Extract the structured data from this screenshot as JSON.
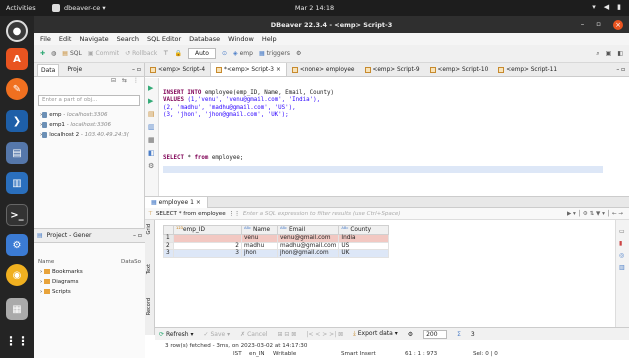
{
  "topbar": {
    "activities": "Activities",
    "app_name": "dbeaver-ce ▾",
    "clock": "Mar 2  14:18"
  },
  "window": {
    "title": "DBeaver 22.3.4 - <emp> Script-3"
  },
  "menubar": [
    "File",
    "Edit",
    "Navigate",
    "Search",
    "SQL Editor",
    "Database",
    "Window",
    "Help"
  ],
  "toolbar": {
    "sql": "SQL",
    "commit": "Commit",
    "rollback": "Rollback",
    "transaction_mode": "Auto",
    "schema": "emp",
    "triggers": "triggers"
  },
  "left_panel": {
    "tabs": [
      "Data",
      "Proje"
    ],
    "filter_placeholder": "Enter a part of obj...",
    "connections": [
      {
        "name": "emp",
        "host": "- localhost:3306"
      },
      {
        "name": "emp1",
        "host": "- localhost:3306"
      },
      {
        "name": "localhost 2",
        "host": "- 103.40.49.24:3("
      }
    ]
  },
  "project_panel": {
    "title": "Project - Gener",
    "col_name": "Name",
    "col_datasource": "DataSo",
    "items": [
      "Bookmarks",
      "Diagrams",
      "Scripts"
    ]
  },
  "editor_tabs": [
    {
      "label": "<emp> Script-4",
      "active": false
    },
    {
      "label": "*<emp> Script-3",
      "active": true
    },
    {
      "label": "<none> employee",
      "active": false
    },
    {
      "label": "<emp> Script-9",
      "active": false
    },
    {
      "label": "<emp> Script-10",
      "active": false
    },
    {
      "label": "<emp> Script-11",
      "active": false
    }
  ],
  "code": {
    "line1_kw": "INSERT INTO",
    "line1_rest": " employee(emp_ID, Name, Email, County)",
    "line2_kw": "VALUES",
    "line2_rest": " (1,'venu', 'venu@gmail.com', 'India'),",
    "line3": "(2, 'madhu', 'madhu@gmail.com', 'US'),",
    "line4": "(3, 'jhon', 'jhon@gmail.com', 'UK');",
    "select_kw1": "SELECT",
    "select_mid": " * ",
    "select_kw2": "from",
    "select_rest": " employee;"
  },
  "results": {
    "tab": "employee 1",
    "filter_query": "SELECT * from employee",
    "filter_placeholder": "Enter a SQL expression to filter results (use Ctrl+Space)",
    "vtabs": [
      "Grid",
      "Text",
      "Record"
    ],
    "columns": [
      "emp_ID",
      "Name",
      "Email",
      "County"
    ],
    "rows": [
      {
        "n": "1",
        "emp_id": "",
        "name": "venu",
        "email": "venu@gmail.com",
        "county": "India"
      },
      {
        "n": "2",
        "emp_id": "2",
        "name": "madhu",
        "email": "madhu@gmail.com",
        "county": "US"
      },
      {
        "n": "3",
        "emp_id": "3",
        "name": "jhon",
        "email": "jhon@gmail.com",
        "county": "UK"
      }
    ],
    "refresh": "Refresh",
    "save": "Save",
    "cancel": "Cancel",
    "export": "Export data",
    "fetch_size": "200",
    "row_count": "3",
    "status": "3 row(s) fetched - 3ms, on 2023-03-02 at 14:17:30"
  },
  "statusbar": {
    "tz": "IST",
    "locale": "en_IN",
    "mode": "Writable",
    "insert": "Smart Insert",
    "position": "61 : 1 : 973",
    "selection": "Sel: 0 | 0"
  }
}
